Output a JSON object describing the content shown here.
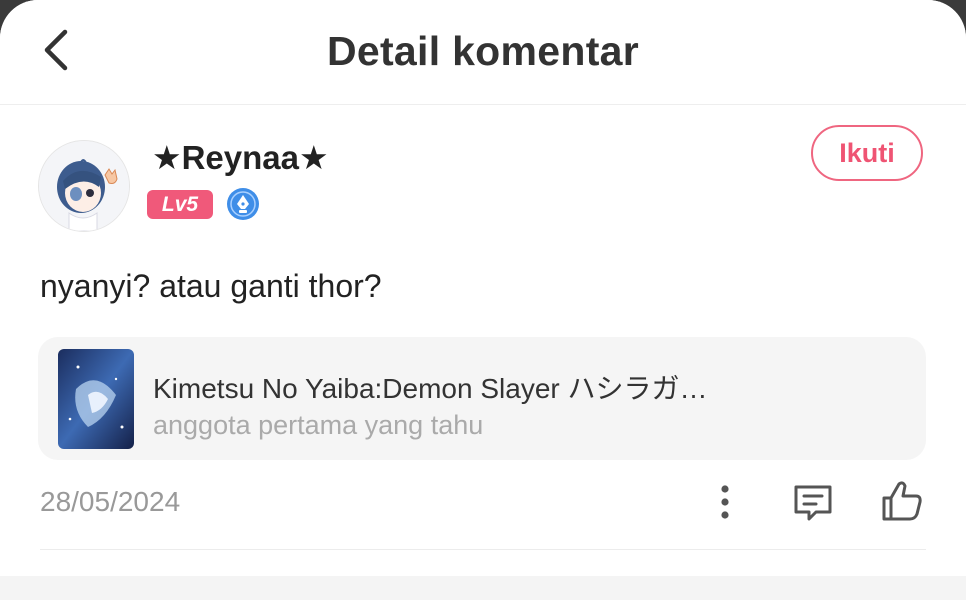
{
  "header": {
    "title": "Detail komentar",
    "back_icon": "chevron-left-icon"
  },
  "user": {
    "name": "★Reynaa★",
    "level": "Lv5",
    "badge_icon": "pen-nib-icon",
    "follow_label": "Ikuti"
  },
  "comment": {
    "text": "nyanyi? atau ganti thor?"
  },
  "book_card": {
    "title": "Kimetsu No Yaiba:Demon Slayer ハシラガ…",
    "subtitle": "anggota pertama yang tahu"
  },
  "footer": {
    "date": "28/05/2024",
    "icons": [
      "more-vertical-icon",
      "reply-icon",
      "thumbs-up-icon"
    ]
  },
  "colors": {
    "accent": "#ef5473",
    "level_badge": "#f0597a",
    "blue_badge": "#3f8ee8"
  }
}
